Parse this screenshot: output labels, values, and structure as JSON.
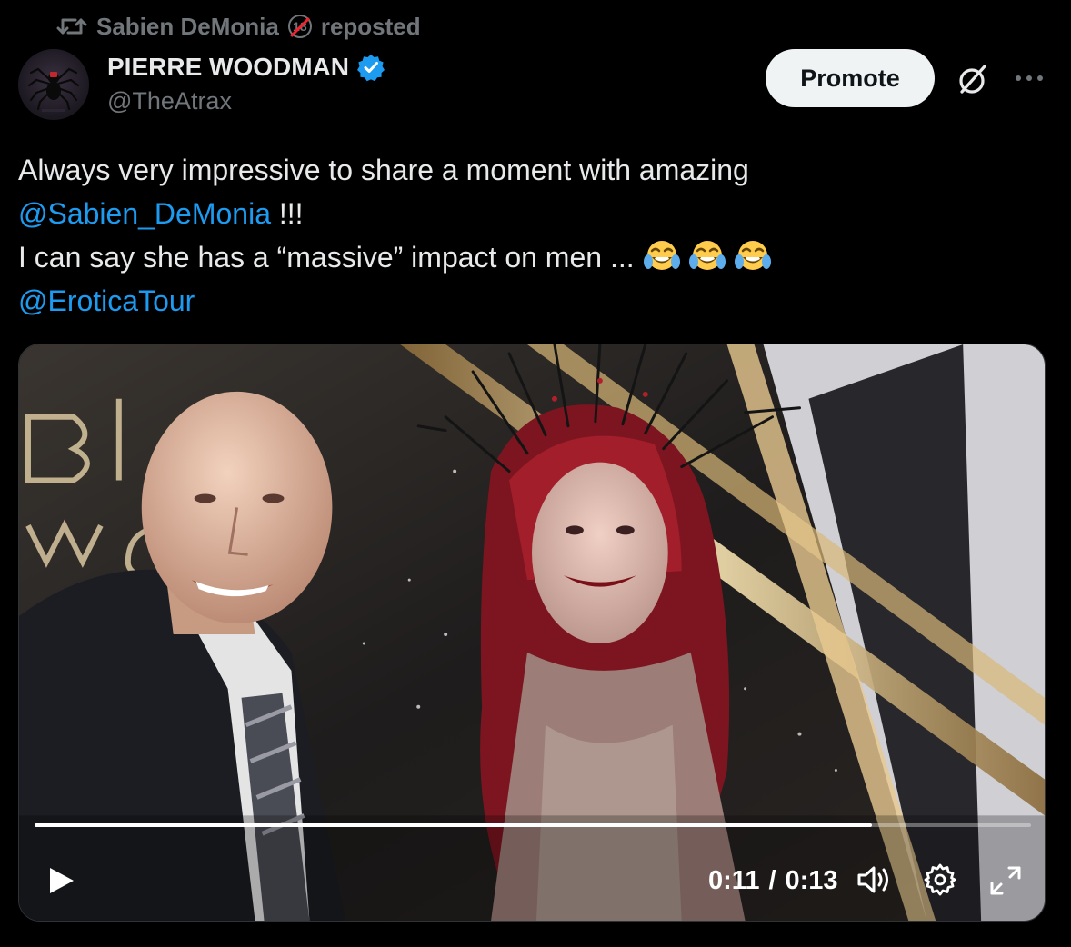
{
  "repost": {
    "reposter_name": "Sabien DeMonia",
    "age_badge": "18",
    "suffix": "reposted"
  },
  "author": {
    "name": "PIERRE WOODMAN",
    "handle": "@TheAtrax"
  },
  "header": {
    "promote_label": "Promote"
  },
  "tweet": {
    "line1": "Always very impressive to share a moment with amazing",
    "mention1": "@Sabien_DeMonia",
    "after_mention1": " !!!",
    "line3": "I can say she has a “massive” impact on men ...",
    "emojis": [
      "face-with-tears-of-joy",
      "face-with-tears-of-joy",
      "face-with-tears-of-joy"
    ],
    "mention2": "@EroticaTour"
  },
  "video": {
    "progress": 0.84,
    "current_time": "0:11",
    "separator": "/",
    "duration": "0:13"
  },
  "colors": {
    "background": "#000000",
    "text": "#e7e9ea",
    "secondary_text": "#71767b",
    "link": "#1d9bf0",
    "verified": "#1d9bf0",
    "promote_bg": "#eff3f4"
  },
  "icons": {
    "repost": "repost-icon",
    "age_badge": "age-restricted-18-icon",
    "verified": "verified-badge-icon",
    "grok": "grok-icon",
    "more": "more-icon",
    "play": "play-icon",
    "volume": "volume-icon",
    "settings": "gear-icon",
    "fullscreen": "fullscreen-icon"
  }
}
